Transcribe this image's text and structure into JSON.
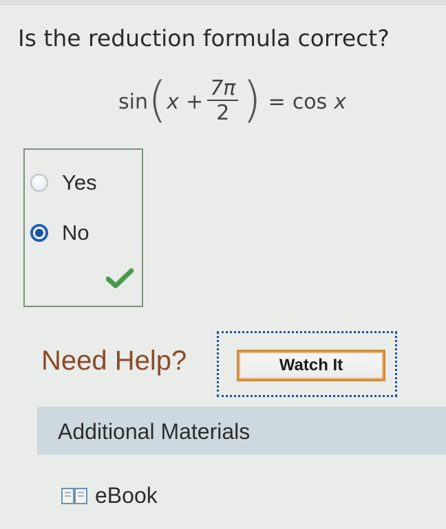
{
  "question": {
    "text": "Is the reduction formula correct?",
    "formula": {
      "func": "sin",
      "var_x": "x",
      "plus": "+",
      "numerator": "7π",
      "denominator": "2",
      "equals": "=",
      "rhs_func": "cos",
      "rhs_var": "x"
    }
  },
  "options": [
    {
      "label": "Yes",
      "selected": false
    },
    {
      "label": "No",
      "selected": true
    }
  ],
  "result": {
    "icon": "checkmark-icon",
    "color": "#4a9a4e"
  },
  "help": {
    "need_help": "Need Help?",
    "watch_label": "Watch It"
  },
  "materials": {
    "title": "Additional Materials",
    "ebook_label": "eBook",
    "ebook_icon": "book-icon"
  },
  "colors": {
    "radio_selected": "#1a4fa6",
    "need_help": "#8a4a2a",
    "watch_border": "#d38a3a",
    "focus_outline": "#1f4ea8",
    "materials_bar": "#cdd9de"
  }
}
